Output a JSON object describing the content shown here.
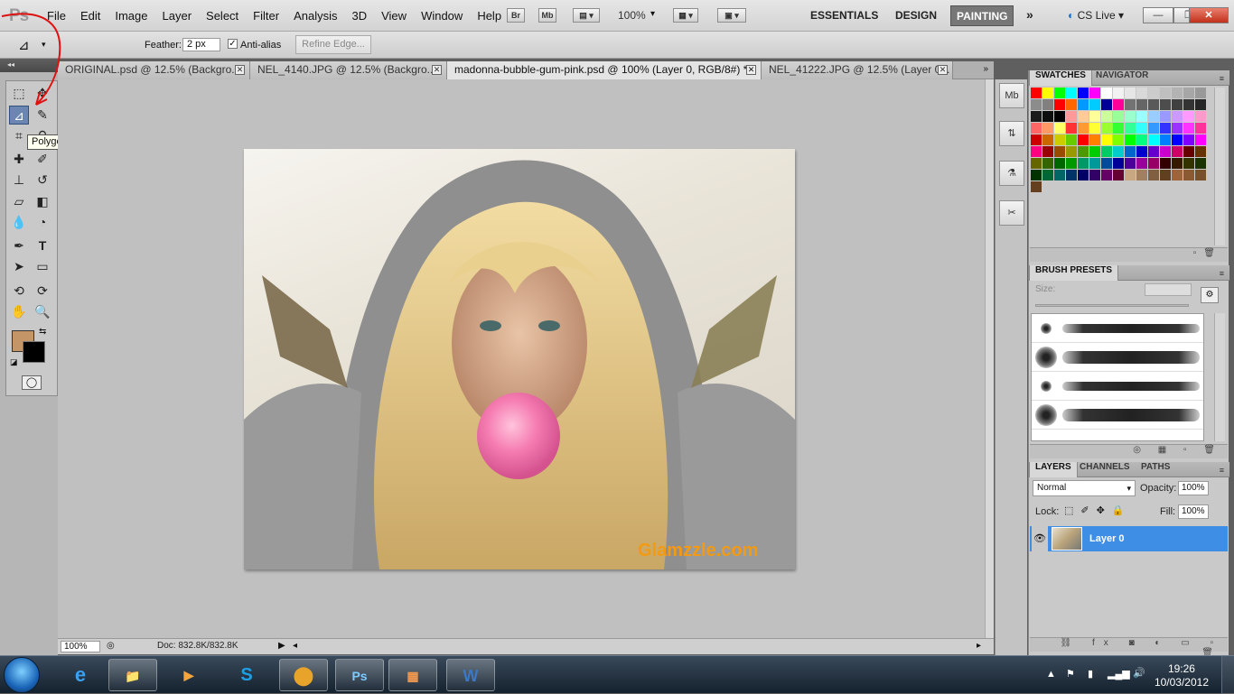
{
  "app": {
    "logo": "Ps"
  },
  "menubar": {
    "items": [
      "File",
      "Edit",
      "Image",
      "Layer",
      "Select",
      "Filter",
      "Analysis",
      "3D",
      "View",
      "Window",
      "Help"
    ],
    "bridge_label": "Br",
    "minibridge_label": "Mb",
    "zoom": "100%",
    "workspaces": [
      "ESSENTIALS",
      "DESIGN",
      "PAINTING"
    ],
    "active_workspace": "PAINTING",
    "more": "»",
    "cs_live": "CS Live",
    "window_controls": {
      "minimize": "—",
      "restore": "❐",
      "close": "✕"
    }
  },
  "options": {
    "feather_label": "Feather:",
    "feather_value": "2 px",
    "antialias_label": "Anti-alias",
    "antialias_checked": true,
    "refine_edge": "Refine Edge..."
  },
  "tabs": [
    {
      "label": "ORIGINAL.psd @ 12.5% (Backgro...",
      "active": false
    },
    {
      "label": "NEL_4140.JPG @ 12.5% (Backgro...",
      "active": false
    },
    {
      "label": "madonna-bubble-gum-pink.psd @ 100% (Layer 0, RGB/8#) *",
      "active": true
    },
    {
      "label": "NEL_41222.JPG @ 12.5% (Layer 0...",
      "active": false
    }
  ],
  "tooltip": "Polygonal Lasso Tool (L)",
  "colors": {
    "foreground": "#c49566",
    "background": "#000000",
    "accent": "#3f8ee6"
  },
  "canvas": {
    "watermark": "Glamzzle.com"
  },
  "status": {
    "zoom": "100%",
    "doc": "Doc: 832.8K/832.8K"
  },
  "panels": {
    "swatches_tabs": [
      "SWATCHES",
      "NAVIGATOR"
    ],
    "brush_tabs": [
      "BRUSH PRESETS"
    ],
    "brush_size_label": "Size:",
    "layers_tabs": [
      "LAYERS",
      "CHANNELS",
      "PATHS"
    ],
    "blend_mode": "Normal",
    "opacity_label": "Opacity:",
    "opacity_value": "100%",
    "lock_label": "Lock:",
    "fill_label": "Fill:",
    "fill_value": "100%",
    "layer_name": "Layer 0"
  },
  "swatch_colors": [
    "#ff0000",
    "#ffff00",
    "#00ff00",
    "#00ffff",
    "#0000ff",
    "#ff00ff",
    "#ffffff",
    "#f2f2f2",
    "#e6e6e6",
    "#d9d9d9",
    "#cccccc",
    "#bfbfbf",
    "#b3b3b3",
    "#a6a6a6",
    "#999999",
    "#8c8c8c",
    "#808080",
    "#ff0000",
    "#ff6600",
    "#0099ff",
    "#00ccff",
    "#000099",
    "#ff0099",
    "#737373",
    "#666666",
    "#595959",
    "#4d4d4d",
    "#404040",
    "#333333",
    "#262626",
    "#1a1a1a",
    "#0d0d0d",
    "#000000",
    "#ff9999",
    "#ffcc99",
    "#ffff99",
    "#ccff99",
    "#99ff99",
    "#99ffcc",
    "#99ffff",
    "#99ccff",
    "#9999ff",
    "#cc99ff",
    "#ff99ff",
    "#ff99cc",
    "#ff6666",
    "#ff9966",
    "#ffff66",
    "#ff3333",
    "#ff9933",
    "#ffff33",
    "#99ff33",
    "#33ff33",
    "#33ff99",
    "#33ffff",
    "#3399ff",
    "#3333ff",
    "#9933ff",
    "#ff33ff",
    "#ff3399",
    "#cc0000",
    "#cc6600",
    "#cccc00",
    "#66cc00",
    "#ff0000",
    "#ff8000",
    "#ffff00",
    "#80ff00",
    "#00ff00",
    "#00ff80",
    "#00ffff",
    "#0080ff",
    "#0000ff",
    "#8000ff",
    "#ff00ff",
    "#ff0080",
    "#990000",
    "#994c00",
    "#999900",
    "#4c9900",
    "#00cc00",
    "#00cc66",
    "#00cccc",
    "#0066cc",
    "#0000cc",
    "#6600cc",
    "#cc00cc",
    "#cc0066",
    "#660000",
    "#663300",
    "#666600",
    "#336600",
    "#006600",
    "#009900",
    "#009966",
    "#009999",
    "#004c99",
    "#000099",
    "#4c0099",
    "#990099",
    "#990066",
    "#330000",
    "#331a00",
    "#333300",
    "#1a3300",
    "#003300",
    "#006633",
    "#006666",
    "#003366",
    "#000066",
    "#330066",
    "#660066",
    "#660033",
    "#c8a882",
    "#a08060",
    "#806040",
    "#604020",
    "#a0643c",
    "#8c5a32",
    "#78502a",
    "#644020"
  ],
  "taskbar": {
    "apps": [
      "e",
      "📁",
      "▶",
      "S",
      "⬤",
      "Ps",
      "▦",
      "W"
    ],
    "time": "19:26",
    "date": "10/03/2012"
  }
}
